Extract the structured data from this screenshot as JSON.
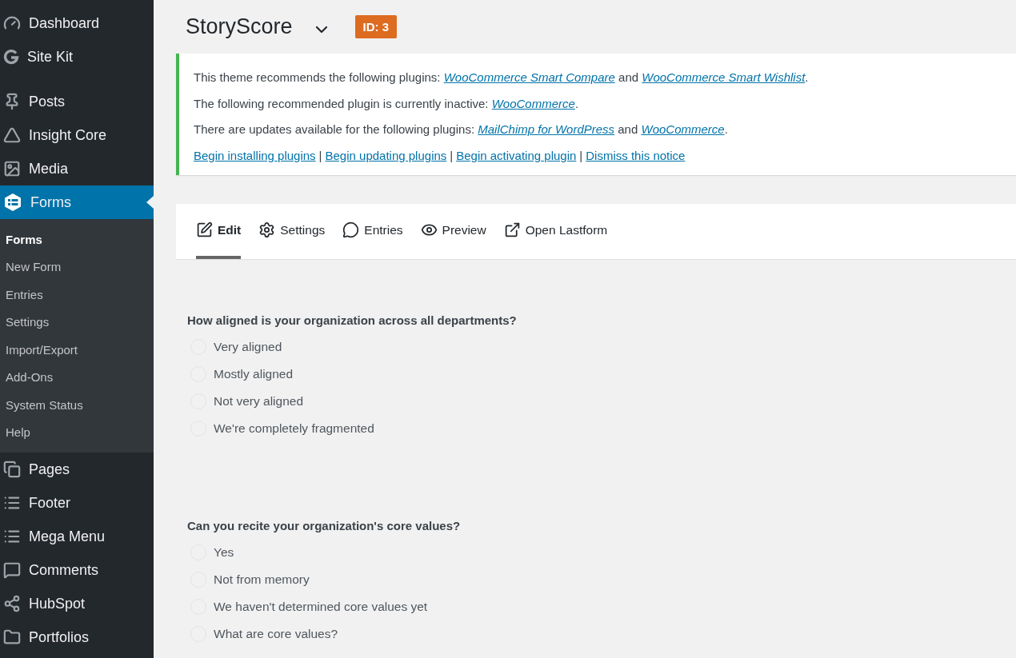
{
  "sidebar": {
    "items": [
      {
        "label": "Dashboard",
        "selected": false
      },
      {
        "label": "Site Kit",
        "selected": false
      },
      {
        "label": "Posts",
        "selected": false
      },
      {
        "label": "Insight Core",
        "selected": false
      },
      {
        "label": "Media",
        "selected": false
      },
      {
        "label": "Forms",
        "selected": true,
        "children": [
          {
            "label": "Forms",
            "selected": true
          },
          {
            "label": "New Form",
            "selected": false
          },
          {
            "label": "Entries",
            "selected": false
          },
          {
            "label": "Settings",
            "selected": false
          },
          {
            "label": "Import/Export",
            "selected": false
          },
          {
            "label": "Add-Ons",
            "selected": false
          },
          {
            "label": "System Status",
            "selected": false
          },
          {
            "label": "Help",
            "selected": false
          }
        ]
      },
      {
        "label": "Pages",
        "selected": false
      },
      {
        "label": "Footer",
        "selected": false
      },
      {
        "label": "Mega Menu",
        "selected": false
      },
      {
        "label": "Comments",
        "selected": false
      },
      {
        "label": "HubSpot",
        "selected": false
      },
      {
        "label": "Portfolios",
        "selected": false
      }
    ]
  },
  "header": {
    "title": "StoryScore",
    "id_badge": "ID: 3"
  },
  "notice": {
    "lines": [
      {
        "parts": [
          {
            "kind": "text",
            "text": "This theme recommends the following plugins: "
          },
          {
            "kind": "link",
            "text": "WooCommerce Smart Compare"
          },
          {
            "kind": "text",
            "text": " and "
          },
          {
            "kind": "link",
            "text": "WooCommerce Smart Wishlist"
          },
          {
            "kind": "text",
            "text": "."
          }
        ]
      },
      {
        "parts": [
          {
            "kind": "text",
            "text": "The following recommended plugin is currently inactive: "
          },
          {
            "kind": "link",
            "text": "WooCommerce"
          },
          {
            "kind": "text",
            "text": "."
          }
        ]
      },
      {
        "parts": [
          {
            "kind": "text",
            "text": "There are updates available for the following plugins: "
          },
          {
            "kind": "link",
            "text": "MailChimp for WordPress"
          },
          {
            "kind": "text",
            "text": " and "
          },
          {
            "kind": "link",
            "text": "WooCommerce"
          },
          {
            "kind": "text",
            "text": "."
          }
        ]
      }
    ],
    "actions": [
      {
        "kind": "link",
        "text": "Begin installing plugins"
      },
      {
        "kind": "separator",
        "text": "|"
      },
      {
        "kind": "link",
        "text": "Begin updating plugins"
      },
      {
        "kind": "separator",
        "text": "|"
      },
      {
        "kind": "link",
        "text": "Begin activating plugin"
      },
      {
        "kind": "separator",
        "text": "|"
      },
      {
        "kind": "link",
        "text": "Dismiss this notice"
      }
    ]
  },
  "tabs": [
    {
      "label": "Edit",
      "selected": true
    },
    {
      "label": "Settings",
      "selected": false
    },
    {
      "label": "Entries",
      "selected": false
    },
    {
      "label": "Preview",
      "selected": false
    },
    {
      "label": "Open Lastform",
      "selected": false
    }
  ],
  "questions": [
    {
      "label": "How aligned is your organization across all departments?",
      "options": [
        {
          "label": "Very aligned",
          "selected": false
        },
        {
          "label": "Mostly aligned",
          "selected": false
        },
        {
          "label": "Not very aligned",
          "selected": false
        },
        {
          "label": "We're completely fragmented",
          "selected": false
        }
      ]
    },
    {
      "label": "Can you recite your organization's core values?",
      "options": [
        {
          "label": "Yes",
          "selected": false
        },
        {
          "label": "Not from memory",
          "selected": false
        },
        {
          "label": "We haven't determined core values yet",
          "selected": false
        },
        {
          "label": "What are core values?",
          "selected": false
        }
      ]
    }
  ]
}
